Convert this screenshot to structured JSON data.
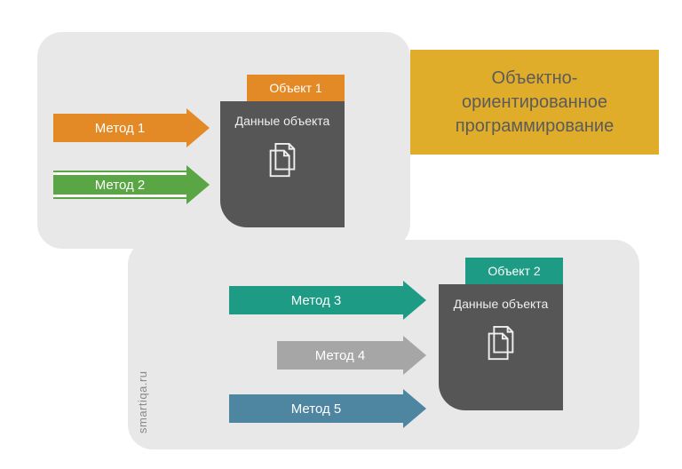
{
  "title": "Объектно-ориентированное программирование",
  "objects": [
    {
      "tag": "Объект 1",
      "body_label": "Данные объекта"
    },
    {
      "tag": "Объект 2",
      "body_label": "Данные объекта"
    }
  ],
  "methods": [
    {
      "label": "Метод 1",
      "color": "orange"
    },
    {
      "label": "Метод 2",
      "color": "green"
    },
    {
      "label": "Метод 3",
      "color": "teal"
    },
    {
      "label": "Метод 4",
      "color": "gray"
    },
    {
      "label": "Метод 5",
      "color": "blue"
    }
  ],
  "watermark": "smartiqa.ru"
}
